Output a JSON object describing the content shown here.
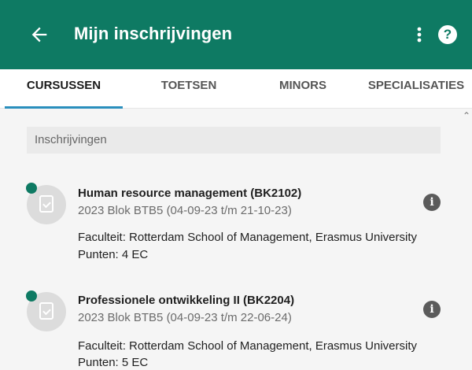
{
  "appbar": {
    "title": "Mijn inschrijvingen",
    "back_icon": "arrow-left-icon",
    "menu_icon": "more-vertical-icon",
    "help_label": "?"
  },
  "tabs": [
    {
      "label": "CURSUSSEN",
      "active": true
    },
    {
      "label": "TOETSEN",
      "active": false
    },
    {
      "label": "MINORS",
      "active": false
    },
    {
      "label": "SPECIALISATIES",
      "active": false
    }
  ],
  "section": {
    "header": "Inschrijvingen"
  },
  "courses": [
    {
      "title": "Human resource management (BK2102)",
      "period": "2023 Blok BTB5 (04-09-23 t/m 21-10-23)",
      "faculty": "Faculteit: Rotterdam School of Management, Erasmus University",
      "points": "Punten: 4 EC"
    },
    {
      "title": "Professionele ontwikkeling II (BK2204)",
      "period": "2023 Blok BTB5 (04-09-23 t/m 22-06-24)",
      "faculty": "Faculteit: Rotterdam School of Management, Erasmus University",
      "points": "Punten: 5 EC"
    }
  ],
  "colors": {
    "primary": "#0e7a63",
    "tab_indicator": "#2a8fbd",
    "background": "#f5f5f5"
  }
}
